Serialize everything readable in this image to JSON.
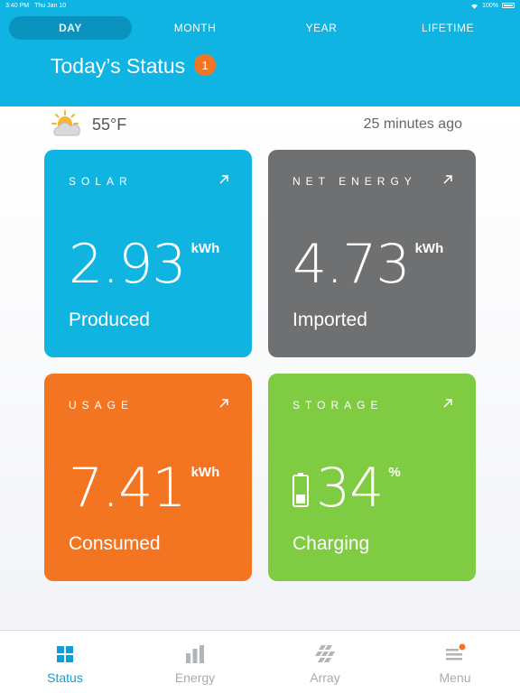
{
  "status_bar": {
    "time": "3:40 PM",
    "date": "Thu Jan 10",
    "battery": "100%"
  },
  "tabs": [
    {
      "label": "DAY",
      "active": true
    },
    {
      "label": "MONTH",
      "active": false
    },
    {
      "label": "YEAR",
      "active": false
    },
    {
      "label": "LIFETIME",
      "active": false
    }
  ],
  "header": {
    "title": "Today’s Status",
    "badge": "1"
  },
  "weather": {
    "icon": "partly-cloudy-icon",
    "temperature": "55°F",
    "updated": "25 minutes ago"
  },
  "cards": {
    "solar": {
      "label": "SOLAR",
      "value": "2.93",
      "unit": "kWh",
      "sub": "Produced",
      "color": "#10b4e0"
    },
    "net": {
      "label": "NET ENERGY",
      "value": "4.73",
      "unit": "kWh",
      "sub": "Imported",
      "color": "#6e7071"
    },
    "usage": {
      "label": "USAGE",
      "value": "7.41",
      "unit": "kWh",
      "sub": "Consumed",
      "color": "#f47521"
    },
    "storage": {
      "label": "STORAGE",
      "value": "34",
      "unit": "%",
      "sub": "Charging",
      "color": "#7fcb42"
    }
  },
  "nav": [
    {
      "label": "Status",
      "icon": "grid-icon",
      "active": true
    },
    {
      "label": "Energy",
      "icon": "bar-chart-icon",
      "active": false
    },
    {
      "label": "Array",
      "icon": "solar-panel-icon",
      "active": false
    },
    {
      "label": "Menu",
      "icon": "menu-icon",
      "active": false
    }
  ],
  "colors": {
    "accent": "#0fb4e3",
    "badge": "#f47521",
    "nav_active": "#109fd4"
  }
}
